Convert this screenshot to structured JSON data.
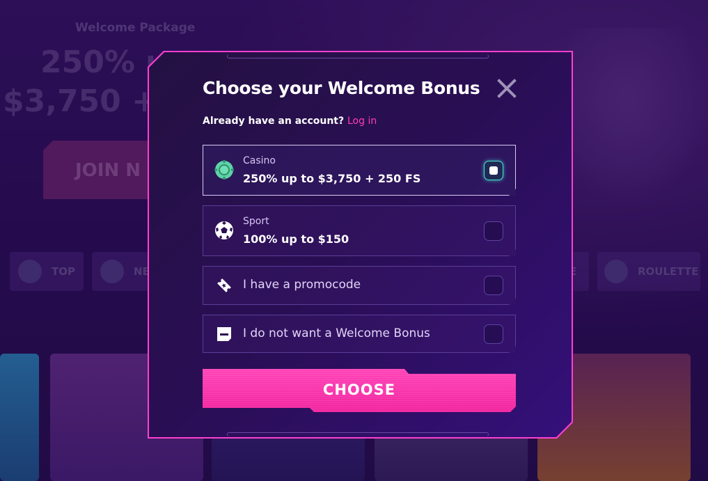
{
  "background": {
    "welcome_label": "Welcome Package",
    "headline_line1": "250% u",
    "headline_line2": "$3,750 +",
    "join_label": "JOIN N",
    "categories": [
      {
        "label": "TOP"
      },
      {
        "label": "NE"
      },
      {
        "label": "E"
      },
      {
        "label": "ROULETTE"
      }
    ]
  },
  "modal": {
    "title": "Choose your Welcome Bonus",
    "login_prompt": "Already have an account?",
    "login_link": "Log in",
    "options": [
      {
        "icon": "casino-chip-icon",
        "subtitle": "Casino",
        "title": "250% up to $3,750 + 250 FS",
        "selected": true
      },
      {
        "icon": "soccer-ball-icon",
        "subtitle": "Sport",
        "title": "100% up to $150",
        "selected": false
      },
      {
        "icon": "ticket-icon",
        "label": "I have a promocode",
        "selected": false
      },
      {
        "icon": "minus-square-icon",
        "label": "I do not want a Welcome Bonus",
        "selected": false
      }
    ],
    "choose_label": "CHOOSE"
  },
  "colors": {
    "accent": "#ff3fd0",
    "button": "#f2259f",
    "link": "#ff3fb4",
    "selected_radio": "#47e3d2"
  }
}
